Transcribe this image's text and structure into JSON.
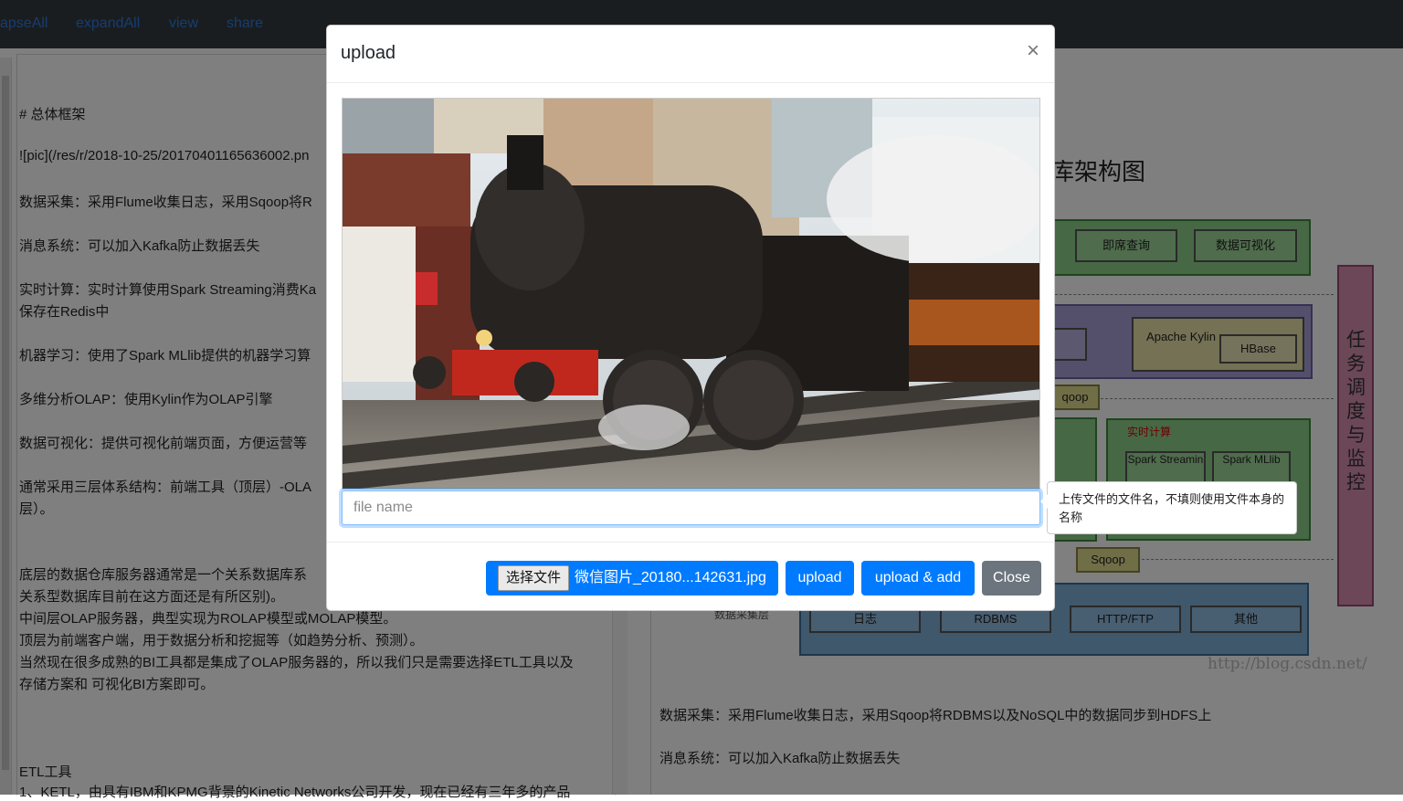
{
  "nav": {
    "items": [
      "apseAll",
      "expandAll",
      "view",
      "share"
    ]
  },
  "editor": {
    "lines": [
      "# 总体框架",
      "![pic](/res/r/2018-10-25/20170401165636002.pn",
      "数据采集：采用Flume收集日志，采用Sqoop将R",
      "消息系统：可以加入Kafka防止数据丢失",
      "实时计算：实时计算使用Spark Streaming消费Ka",
      "保存在Redis中",
      "机器学习：使用了Spark MLlib提供的机器学习算",
      "多维分析OLAP：使用Kylin作为OLAP引擎",
      "数据可视化：提供可视化前端页面，方便运营等",
      "通常采用三层体系结构：前端工具（顶层）-OLA",
      "层）。",
      "底层的数据仓库服务器通常是一个关系数据库系",
      "关系型数据库目前在这方面还是有所区别)。",
      "中间层OLAP服务器，典型实现为ROLAP模型或MOLAP模型。",
      "顶层为前端客户端，用于数据分析和挖掘等（如趋势分析、预测）。",
      "当然现在很多成熟的BI工具都是集成了OLAP服务器的，所以我们只是需要选择ETL工具以及",
      "存储方案和 可视化BI方案即可。",
      "ETL工具",
      "1、KETL，由具有IBM和KPMG背景的Kinetic Networks公司开发，现在已经有三年多的产品"
    ]
  },
  "preview": {
    "arch_title": "库架构图",
    "boxes": {
      "instant_query": "即席查询",
      "data_viz": "数据可视化",
      "apache_kylin": "Apache Kylin",
      "hbase": "HBase",
      "sqoop_top": "qoop",
      "realtime_label": "实时计算",
      "spark_streaming": "Spark Streamin",
      "spark_mllib": "Spark MLlib",
      "sqoop_bottom": "Sqoop",
      "collect_layer": "数据采集层",
      "log": "日志",
      "rdbms": "RDBMS",
      "http_ftp": "HTTP/FTP",
      "other": "其他",
      "scheduler": "任务调度与监控",
      "watermark": "http://blog.csdn.net/"
    },
    "text_lines": [
      "数据采集：采用Flume收集日志，采用Sqoop将RDBMS以及NoSQL中的数据同步到HDFS上",
      "消息系统：可以加入Kafka防止数据丢失"
    ]
  },
  "modal": {
    "title": "upload",
    "close_symbol": "×",
    "filename_placeholder": "file name",
    "choose_file_label": "选择文件",
    "chosen_file": "微信图片_20180...142631.jpg",
    "upload_label": "upload",
    "upload_add_label": "upload & add",
    "close_label": "Close"
  },
  "tooltip": {
    "text": "上传文件的文件名，不填则使用文件本身的名称"
  },
  "colors": {
    "primary": "#007bff",
    "secondary": "#6c757d",
    "navbar": "#343a40",
    "link": "#2d7be0"
  }
}
